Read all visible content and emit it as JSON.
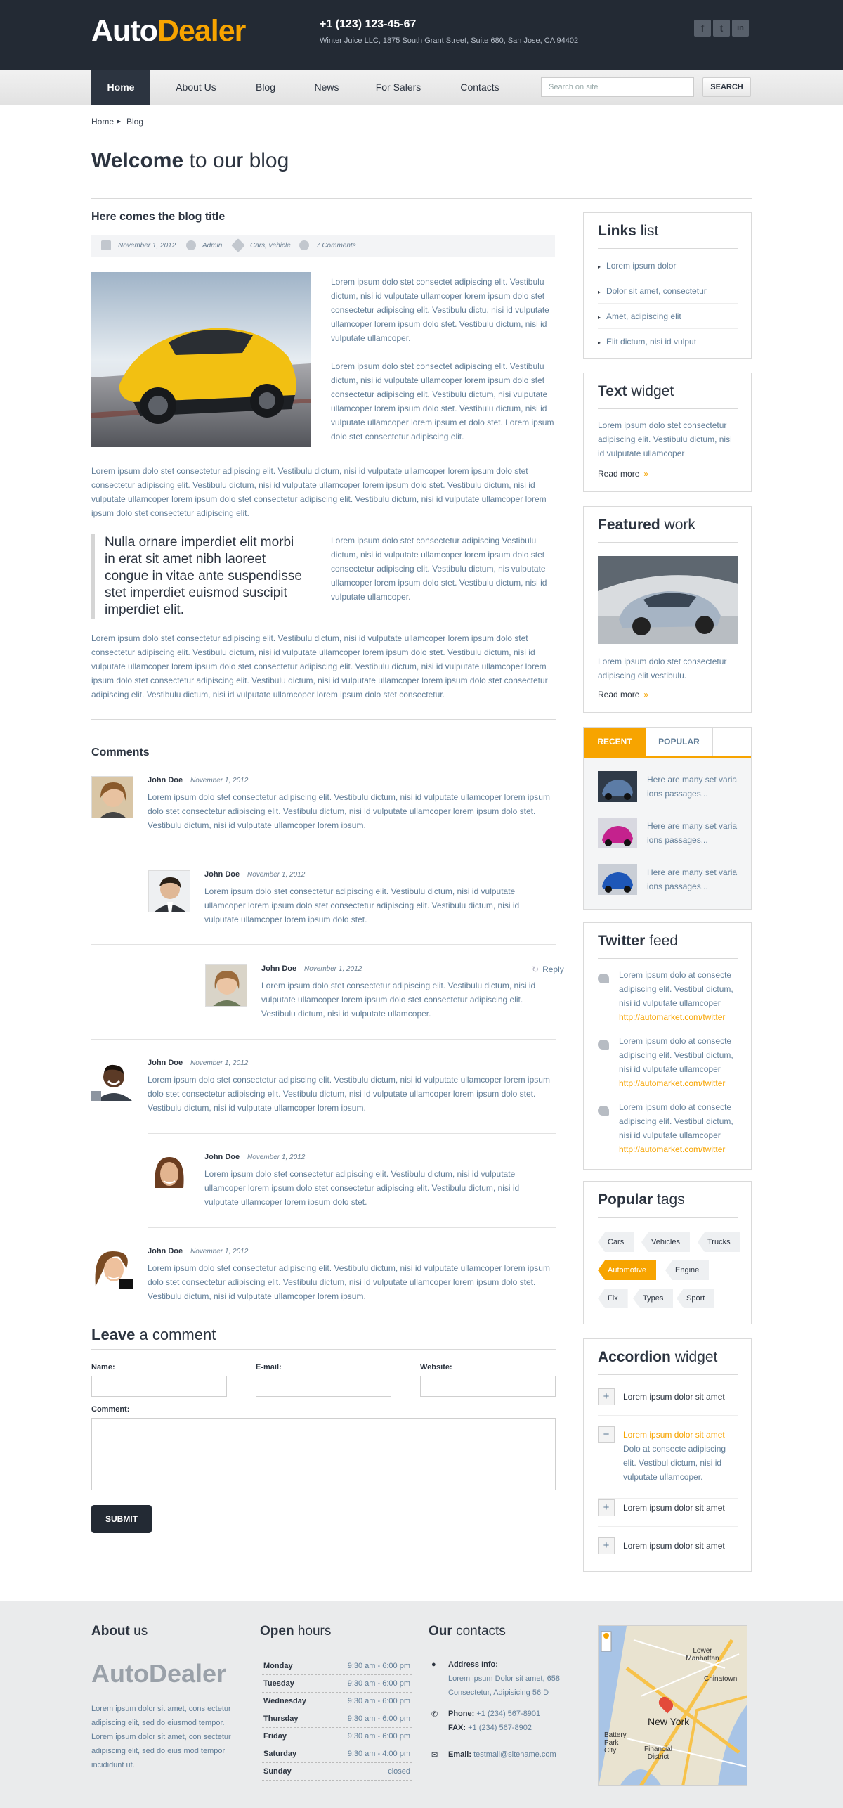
{
  "header": {
    "logo_part1": "Auto",
    "logo_part2": "Dealer",
    "phone": "+1 (123) 123-45-67",
    "address": "Winter Juice LLC, 1875 South Grant Street, Suite 680, San Jose, CA 94402",
    "social": [
      "f",
      "t",
      "in"
    ]
  },
  "nav": {
    "items": [
      "Home",
      "About Us",
      "Blog",
      "News",
      "For Salers",
      "Contacts"
    ],
    "active": "Home",
    "search_placeholder": "Search on site",
    "search_button": "SEARCH"
  },
  "breadcrumb": {
    "home": "Home",
    "current": "Blog"
  },
  "page_title": {
    "bold": "Welcome",
    "rest": "to our blog"
  },
  "post": {
    "title": "Here comes the blog title",
    "date": "November 1, 2012",
    "author": "Admin",
    "tags": "Cars, vehicle",
    "comments": "7 Comments",
    "p1": "Lorem ipsum dolo stet consectet adipiscing elit. Vestibulu dictum, nisi id vulputate ullamcoper lorem ipsum dolo stet consectetur adipiscing elit. Vestibulu dictu, nisi id vulputate ullamcoper lorem ipsum dolo stet. Vestibulu dictum, nisi id vulputate ullamcoper.",
    "p2": "Lorem ipsum dolo stet consectet adipiscing elit. Vestibulu dictum, nisi id vulputate ullamcoper lorem ipsum dolo stet consectetur adipiscing elit. Vestibulu dictum, nisi vulputate ullamcoper lorem ipsum dolo stet. Vestibulu dictum, nisi id vulputate ullamcoper lorem ipsum et dolo stet. Lorem ipsum dolo stet consectetur adipiscing elit.",
    "p3": "Lorem ipsum dolo stet consectetur adipiscing elit. Vestibulu dictum, nisi id vulputate ullamcoper lorem ipsum dolo stet consectetur adipiscing elit. Vestibulu dictum, nisi id vulputate ullamcoper lorem ipsum dolo stet. Vestibulu dictum, nisi id vulputate ullamcoper lorem ipsum dolo stet consectetur adipiscing elit.  Vestibulu dictum, nisi id vulputate ullamcoper lorem ipsum dolo stet consectetur adipiscing elit.",
    "quote": "Nulla ornare imperdiet elit morbi in erat sit amet nibh laoreet congue in vitae ante suspendisse stet imperdiet euismod suscipit imperdiet elit.",
    "p4": "Lorem ipsum dolo stet consectetur adipiscing Vestibulu dictum, nisi id vulputate ullamcoper lorem ipsum dolo stet consectetur adipiscing elit. Vestibulu dictum, nis vulputate ullamcoper lorem ipsum dolo stet. Vestibulu dictum, nisi id vulputate ullamcoper.",
    "p5": "Lorem ipsum dolo stet consectetur adipiscing elit. Vestibulu dictum, nisi id vulputate ullamcoper lorem ipsum dolo stet consectetur adipiscing elit. Vestibulu dictum, nisi id vulputate ullamcoper lorem ipsum dolo stet. Vestibulu dictum, nisi id vulputate ullamcoper lorem ipsum dolo stet consectetur adipiscing elit.  Vestibulu dictum, nisi id vulputate ullamcoper lorem ipsum dolo stet consectetur adipiscing elit. Vestibulu dictum, nisi id vulputate ullamcoper lorem ipsum dolo stet consectetur adipiscing elit. Vestibulu dictum, nisi id vulputate ullamcoper lorem ipsum dolo stet consectetur."
  },
  "comments": {
    "title": "Comments",
    "reply": "Reply",
    "items": [
      {
        "name": "John Doe",
        "date": "November 1, 2012",
        "text": "Lorem ipsum dolo stet consectetur adipiscing elit. Vestibulu dictum, nisi id vulputate ullamcoper lorem ipsum dolo stet consectetur adipiscing elit. Vestibulu dictum, nisi id vulputate ullamcoper lorem ipsum dolo stet. Vestibulu dictum, nisi id vulputate ullamcoper lorem ipsum."
      },
      {
        "name": "John Doe",
        "date": "November 1, 2012",
        "text": "Lorem ipsum dolo stet consectetur adipiscing elit. Vestibulu dictum, nisi id vulputate ullamcoper lorem ipsum dolo stet consectetur adipiscing elit. Vestibulu dictum, nisi id vulputate ullamcoper lorem ipsum dolo stet."
      },
      {
        "name": "John Doe",
        "date": "November 1, 2012",
        "text": "Lorem ipsum dolo stet consectetur adipiscing elit. Vestibulu dictum, nisi id vulputate ullamcoper lorem ipsum dolo stet consectetur adipiscing elit. Vestibulu dictum, nisi id vulputate ullamcoper."
      },
      {
        "name": "John Doe",
        "date": "November 1, 2012",
        "text": "Lorem ipsum dolo stet consectetur adipiscing elit. Vestibulu dictum, nisi id vulputate ullamcoper lorem ipsum dolo stet consectetur adipiscing elit. Vestibulu dictum, nisi id vulputate ullamcoper lorem ipsum dolo stet. Vestibulu dictum, nisi id vulputate ullamcoper lorem ipsum."
      },
      {
        "name": "John Doe",
        "date": "November 1, 2012",
        "text": "Lorem ipsum dolo stet consectetur adipiscing elit. Vestibulu dictum, nisi id vulputate ullamcoper lorem ipsum dolo stet consectetur adipiscing elit. Vestibulu dictum, nisi id vulputate ullamcoper lorem ipsum dolo stet."
      },
      {
        "name": "John Doe",
        "date": "November 1, 2012",
        "text": "Lorem ipsum dolo stet consectetur adipiscing elit. Vestibulu dictum, nisi id vulputate ullamcoper lorem ipsum dolo stet consectetur adipiscing elit. Vestibulu dictum, nisi id vulputate ullamcoper lorem ipsum dolo stet. Vestibulu dictum, nisi id vulputate ullamcoper lorem ipsum."
      }
    ]
  },
  "form": {
    "title_bold": "Leave",
    "title_rest": "a comment",
    "name_label": "Name:",
    "email_label": "E-mail:",
    "website_label": "Website:",
    "comment_label": "Comment:",
    "submit": "SUBMIT"
  },
  "sidebar": {
    "links": {
      "title_bold": "Links",
      "title_rest": "list",
      "items": [
        "Lorem ipsum dolor",
        "Dolor sit amet, consectetur",
        "Amet, adipiscing elit",
        "Elit dictum, nisi id vulput"
      ]
    },
    "text_widget": {
      "title_bold": "Text",
      "title_rest": "widget",
      "text": "Lorem ipsum dolo stet consectetur adipiscing elit. Vestibulu dictum, nisi id vulputate ullamcoper",
      "read_more": "Read more",
      "arrow": "»"
    },
    "featured": {
      "title_bold": "Featured",
      "title_rest": "work",
      "text": "Lorem ipsum dolo stet consectetur adipiscing elit vestibulu.",
      "read_more": "Read more",
      "arrow": "»"
    },
    "tabs": {
      "recent": "RECENT",
      "popular": "POPULAR",
      "items": [
        "Here are many set varia ions passages...",
        "Here are many set varia ions passages...",
        "Here are many set varia ions passages..."
      ]
    },
    "twitter": {
      "title_bold": "Twitter",
      "title_rest": "feed",
      "items": [
        {
          "text": "Lorem ipsum dolo at consecte adipiscing elit. Vestibul dictum, nisi id vulputate ullamcoper",
          "link": "http://automarket.com/twitter"
        },
        {
          "text": "Lorem ipsum dolo at consecte adipiscing elit. Vestibul dictum, nisi id vulputate ullamcoper",
          "link": "http://automarket.com/twitter"
        },
        {
          "text": "Lorem ipsum dolo at consecte adipiscing elit. Vestibul dictum, nisi id vulputate ullamcoper",
          "link": "http://automarket.com/twitter"
        }
      ]
    },
    "tags": {
      "title_bold": "Popular",
      "title_rest": "tags",
      "items": [
        "Cars",
        "Vehicles",
        "Trucks",
        "Automotive",
        "Engine",
        "Fix",
        "Types",
        "Sport"
      ],
      "active": "Automotive"
    },
    "accordion": {
      "title_bold": "Accordion",
      "title_rest": "widget",
      "items": [
        {
          "label": "Lorem ipsum dolor sit amet",
          "open": false
        },
        {
          "label": "Lorem ipsum dolor sit amet",
          "open": true,
          "content": "Dolo at consecte adipiscing elit. Vestibul dictum, nisi id vulputate ullamcoper."
        },
        {
          "label": "Lorem ipsum dolor sit amet",
          "open": false
        },
        {
          "label": "Lorem ipsum dolor sit amet",
          "open": false
        }
      ]
    }
  },
  "footer": {
    "about": {
      "title_bold": "About",
      "title_rest": "us",
      "logo": "AutoDealer",
      "text": "Lorem ipsum dolor sit amet, cons ectetur adipiscing elit, sed do eiusmod tempor. Lorem ipsum dolor sit amet, con sectetur adipiscing elit, sed do eius  mod tempor incididunt ut."
    },
    "hours": {
      "title_bold": "Open",
      "title_rest": "hours",
      "rows": [
        {
          "day": "Monday",
          "time": "9:30 am - 6:00 pm"
        },
        {
          "day": "Tuesday",
          "time": "9:30 am - 6:00 pm"
        },
        {
          "day": "Wednesday",
          "time": "9:30 am - 6:00 pm"
        },
        {
          "day": "Thursday",
          "time": "9:30 am - 6:00 pm"
        },
        {
          "day": "Friday",
          "time": "9:30 am - 6:00 pm"
        },
        {
          "day": "Saturday",
          "time": "9:30 am - 4:00 pm"
        },
        {
          "day": "Sunday",
          "time": "closed"
        }
      ]
    },
    "contacts": {
      "title_bold": "Our",
      "title_rest": "contacts",
      "address_label": "Address Info:",
      "address": "Lorem ipsum Dolor sit amet, 658 Consectetur, Adipisicing 56 D",
      "phone_label": "Phone:",
      "phone": "+1 (234) 567-8901",
      "fax_label": "FAX:",
      "fax": "+1 (234) 567-8902",
      "email_label": "Email:",
      "email": "testmail@sitename.com"
    },
    "map_labels": [
      "Lower Manhattan",
      "Chinatown",
      "New York",
      "Battery Park City",
      "Financial District"
    ]
  },
  "colors": {
    "accent": "#f7a400",
    "dark": "#232a34",
    "text_blue": "#627e98"
  }
}
